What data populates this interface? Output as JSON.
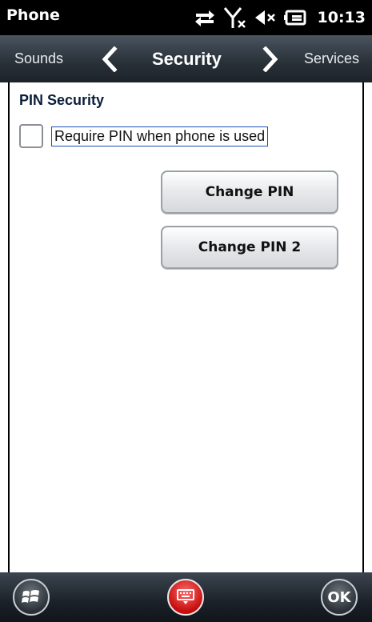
{
  "status_bar": {
    "app_title": "Phone",
    "time": "10:13",
    "icons": [
      "data-transfer-icon",
      "no-signal-icon",
      "speaker-muted-icon",
      "battery-charging-icon"
    ]
  },
  "tabs": {
    "previous": "Sounds",
    "current": "Security",
    "next": "Services"
  },
  "section": {
    "title": "PIN Security"
  },
  "require_pin": {
    "label": "Require PIN when phone is used",
    "checked": false
  },
  "buttons": {
    "change_pin": "Change PIN",
    "change_pin2": "Change PIN 2"
  },
  "softkeys": {
    "start": "start-icon",
    "keyboard": "keyboard-icon",
    "ok": "OK"
  },
  "colors": {
    "section_title": "#0a1e3a",
    "keyboard_accent": "#d61a1a"
  }
}
